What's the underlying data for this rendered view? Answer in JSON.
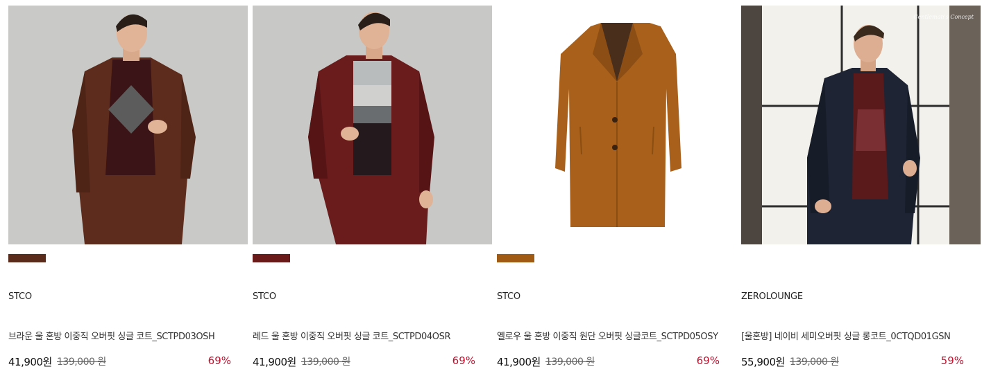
{
  "products": [
    {
      "brand": "STCO",
      "name": "브라운 울 혼방 이중직 오버핏 싱글 코트_SCTPD03OSH",
      "price": "41,900원",
      "original_price": "139,000 원",
      "discount": "69%",
      "swatch_color": "#5a2a1a",
      "image": "model-brown-coat"
    },
    {
      "brand": "STCO",
      "name": "레드 울 혼방 이중직 오버핏 싱글 코트_SCTPD04OSR",
      "price": "41,900원",
      "original_price": "139,000 원",
      "discount": "69%",
      "swatch_color": "#6b1a1a",
      "image": "model-red-coat"
    },
    {
      "brand": "STCO",
      "name": "옐로우 울 혼방 이중직 원단 오버핏 싱글코트_SCTPD05OSY",
      "price": "41,900원",
      "original_price": "139,000 원",
      "discount": "69%",
      "swatch_color": "#a05a14",
      "image": "flat-yellow-coat"
    },
    {
      "brand": "ZEROLOUNGE",
      "name": "[울혼방] 네이비 세미오버핏 싱글 롱코트_0CTQD01GSN",
      "price": "55,900원",
      "original_price": "139,000 원",
      "discount": "59%",
      "image": "model-navy-coat",
      "watermark": "Gentleman's Concept"
    }
  ]
}
